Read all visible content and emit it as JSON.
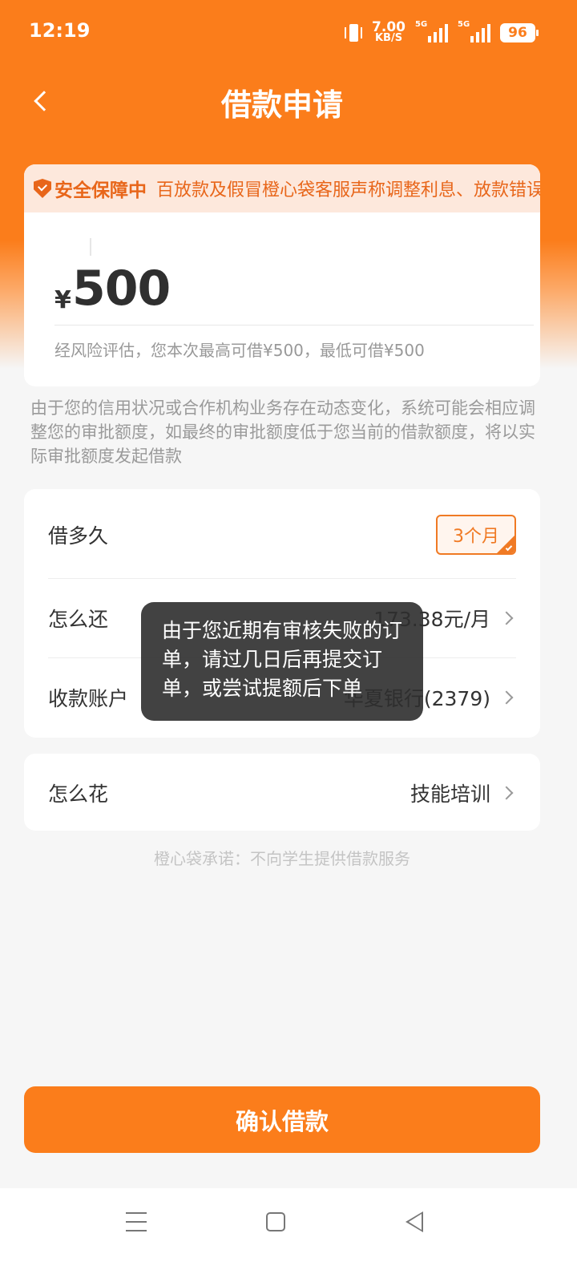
{
  "status_bar": {
    "time": "12:19",
    "net_speed_value": "7.00",
    "net_speed_unit": "KB/S",
    "signal1_label": "5G",
    "signal2_label": "5G",
    "battery": "96"
  },
  "header": {
    "title": "借款申请",
    "back_icon": "chevron-left-icon"
  },
  "amount_card": {
    "notice_badge": "安全保障中",
    "notice_text": "百放款及假冒橙心袋客服声称调整利息、放款错误",
    "currency": "¥",
    "amount": "500",
    "limit_hint": "经风险评估，您本次最高可借¥500，最低可借¥500"
  },
  "disclaimer": "由于您的信用状况或合作机构业务存在动态变化，系统可能会相应调整您的审批额度，如最终的审批额度低于您当前的借款额度，将以实际审批额度发起借款",
  "settings": {
    "term_label": "借多久",
    "term_value": "3个月",
    "repay_label": "怎么还",
    "repay_value": "173.38元/月",
    "account_label": "收款账户",
    "account_value": "华夏银行(2379)",
    "purpose_label": "怎么花",
    "purpose_value": "技能培训"
  },
  "promise": "橙心袋承诺：不向学生提供借款服务",
  "toast": "由于您近期有审核失败的订单，请过几日后再提交订单，或尝试提额后下单",
  "confirm_button": "确认借款",
  "colors": {
    "brand": "#fb7d1b",
    "accent": "#f07a24"
  }
}
